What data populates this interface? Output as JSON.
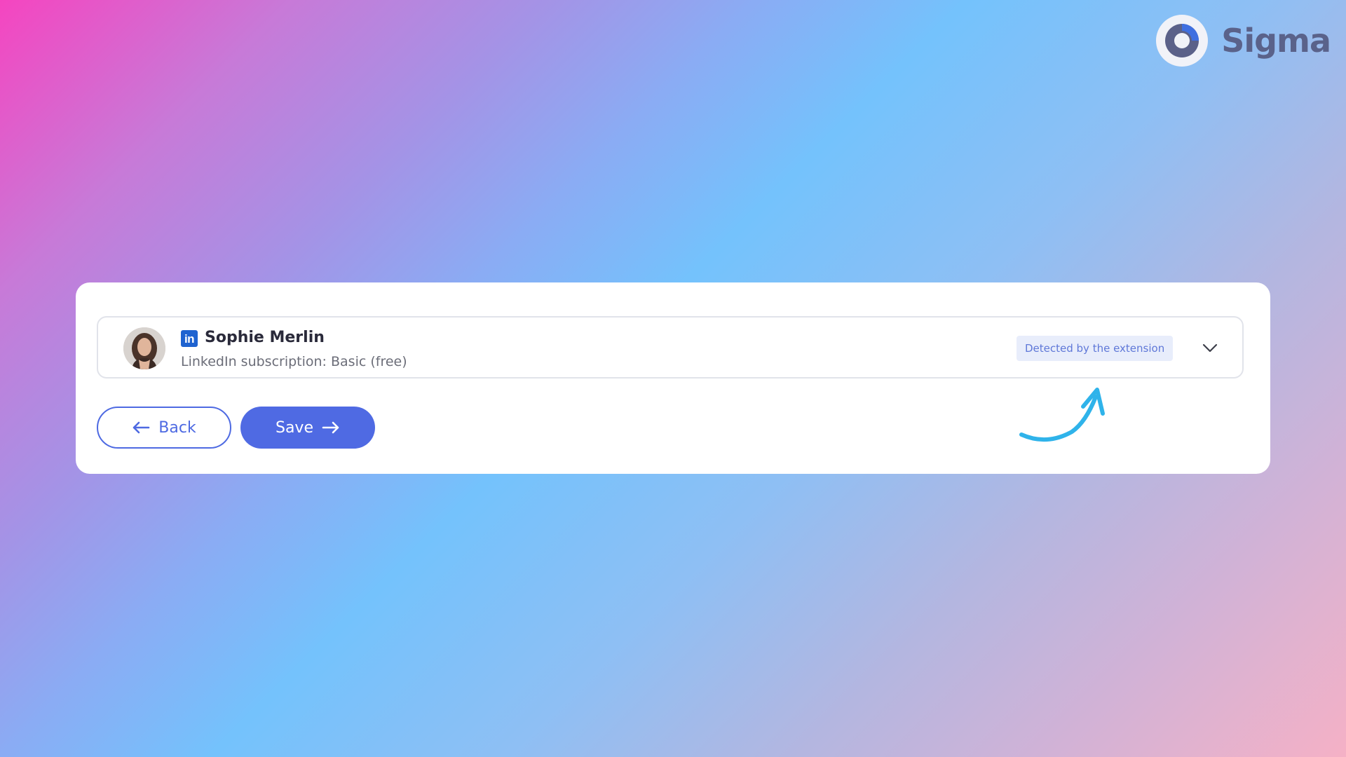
{
  "brand": {
    "name": "Sigma",
    "logo_icon": "ring-logo-icon",
    "color": "#5a628a"
  },
  "contact": {
    "name": "Sophie Merlin",
    "subscription": "LinkedIn subscription: Basic (free)",
    "network_icon": "linkedin-icon",
    "network_icon_text": "in",
    "badge": "Detected by the extension",
    "expand_icon": "chevron-down-icon"
  },
  "actions": {
    "back_label": "Back",
    "back_icon": "arrow-left-icon",
    "save_label": "Save",
    "save_icon": "arrow-right-icon"
  },
  "annotation": {
    "icon": "curved-arrow-icon",
    "color": "#2fb3ea"
  },
  "colors": {
    "primary": "#4f6ae3",
    "badge_bg": "#e8edfb",
    "badge_text": "#5f78d8",
    "linkedin": "#1f63d0"
  }
}
